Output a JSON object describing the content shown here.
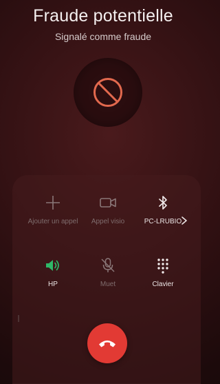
{
  "caller": {
    "title": "Fraude potentielle",
    "subtitle": "Signalé comme fraude",
    "avatar_icon": "blocked-icon",
    "accent_color": "#e2694e"
  },
  "controls": [
    {
      "label": "Ajouter un appel",
      "icon": "plus-icon",
      "enabled": false
    },
    {
      "label": "Appel visio",
      "icon": "video-camera-icon",
      "enabled": false
    },
    {
      "label": "PC-LRUBIO",
      "icon": "bluetooth-icon",
      "enabled": true,
      "has_more": true
    },
    {
      "label": "HP",
      "icon": "speaker-icon",
      "enabled": true,
      "active": true,
      "active_color": "#2fb868"
    },
    {
      "label": "Muet",
      "icon": "mic-off-icon",
      "enabled": false
    },
    {
      "label": "Clavier",
      "icon": "dialpad-icon",
      "enabled": true
    }
  ],
  "hangup": {
    "icon": "hangup-icon",
    "color": "#e23a34"
  }
}
